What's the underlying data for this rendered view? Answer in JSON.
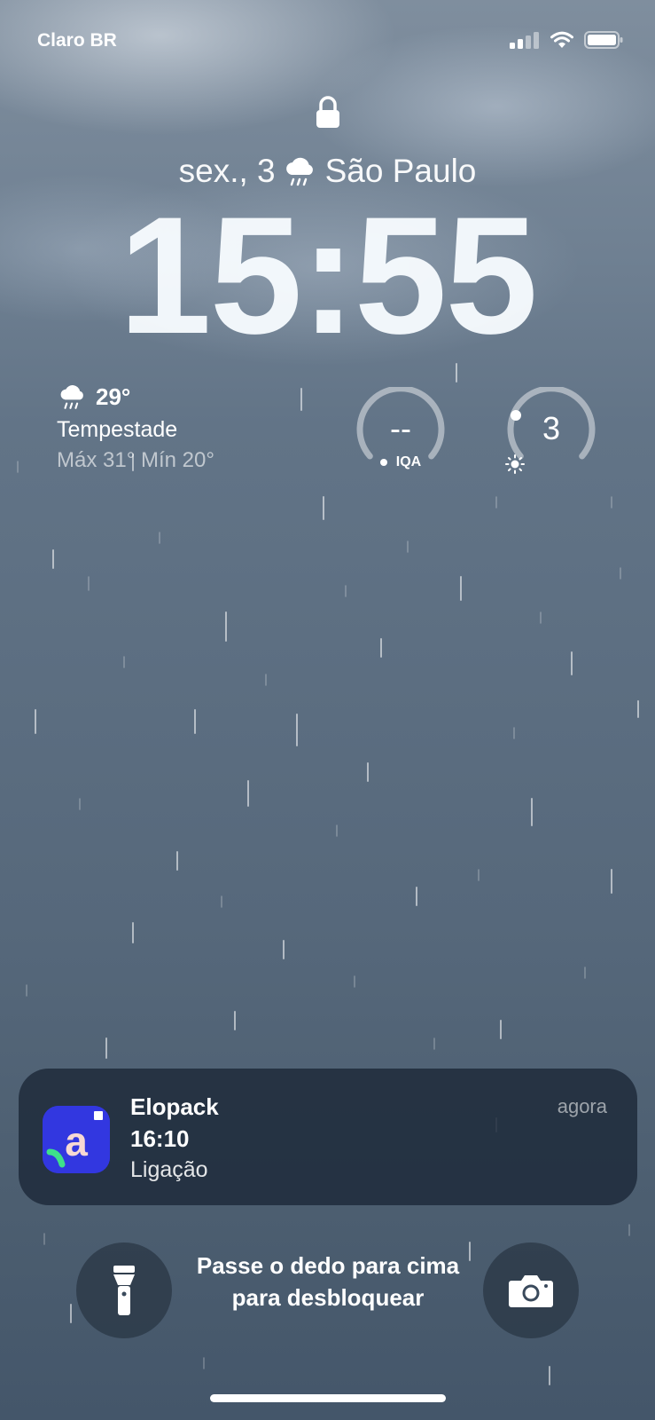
{
  "status_bar": {
    "carrier": "Claro BR"
  },
  "lock_screen": {
    "date": "sex., 3",
    "city": "São Paulo",
    "time": "15:55"
  },
  "weather_widget": {
    "temperature": "29°",
    "condition": "Tempestade",
    "range": "Máx 31° Mín 20°"
  },
  "aqi_widget": {
    "value": "--",
    "label": "IQA"
  },
  "uv_widget": {
    "value": "3",
    "icon": "sun-icon"
  },
  "notification": {
    "app": "Elopack",
    "time": "agora",
    "line1": "16:10",
    "line2": "Ligação",
    "icon_color": "#3237e0"
  },
  "unlock_hint": "Passe o dedo para cima para desbloquear",
  "buttons": {
    "left": "flashlight-icon",
    "right": "camera-icon"
  }
}
